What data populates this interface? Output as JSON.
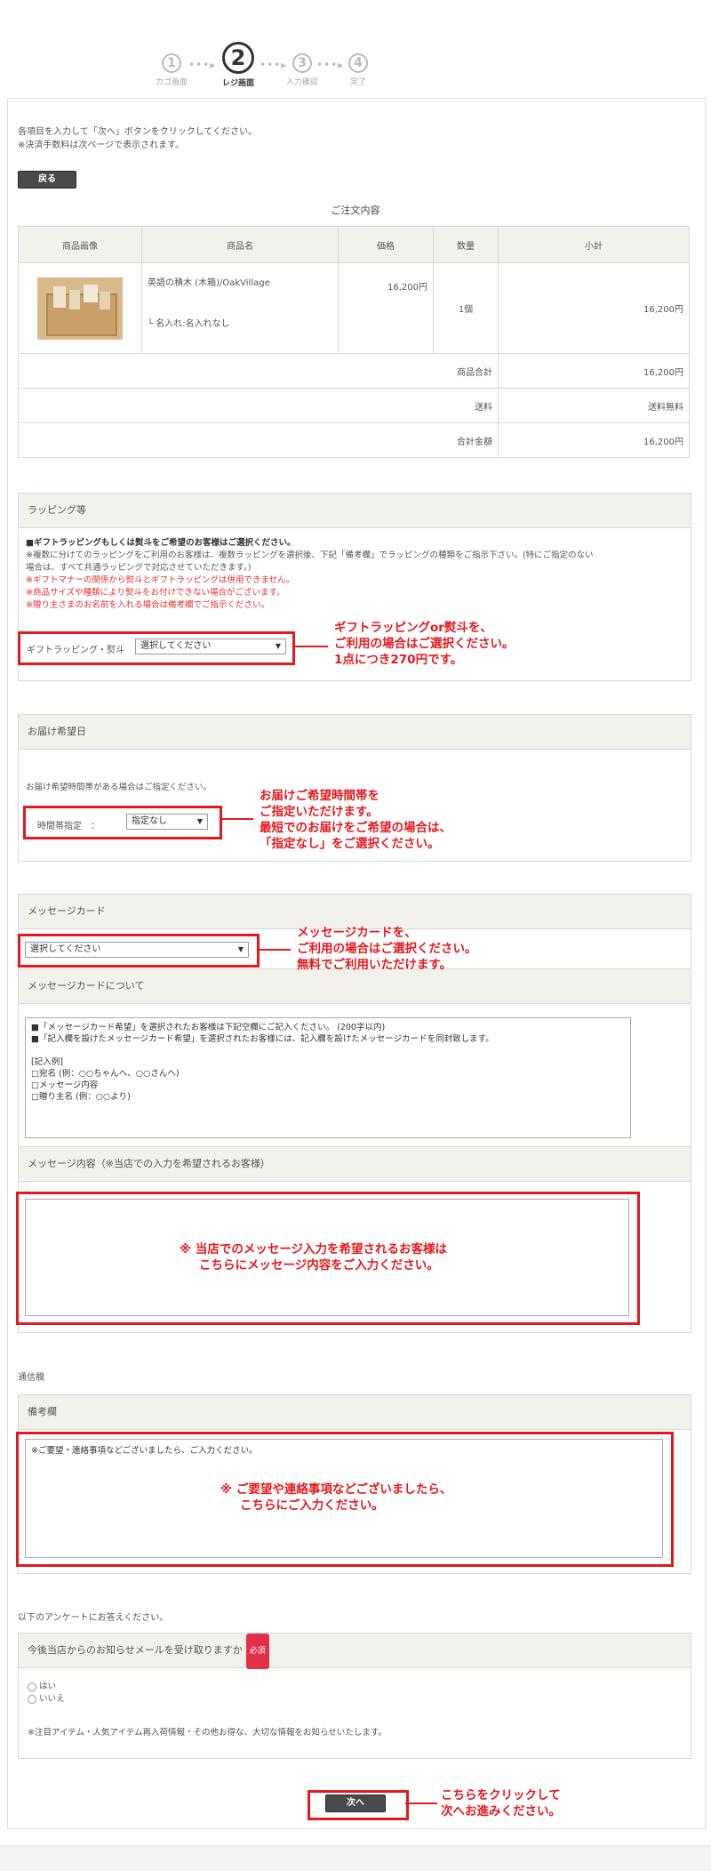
{
  "steps": [
    {
      "num": "①",
      "label": "カゴ画面"
    },
    {
      "num": "②",
      "label": "レジ画面"
    },
    {
      "num": "③",
      "label": "入力確認"
    },
    {
      "num": "④",
      "label": "完了"
    }
  ],
  "steps_dots": "•••▸",
  "intro": {
    "line1": "各項目を入力して「次へ」ボタンをクリックしてください。",
    "line2": "※決済手数料は次ページで表示されます。"
  },
  "back_button": "戻る",
  "order": {
    "title": "ご注文内容",
    "headers": [
      "商品画像",
      "商品名",
      "価格",
      "数量",
      "小計"
    ],
    "item": {
      "name": "英語の積木 (木箱)/OakVillage",
      "option": "└ 名入れ:名入れなし",
      "price": "16,200円",
      "qty": "1個",
      "subtotal": "16,200円"
    },
    "summary": [
      {
        "label": "商品合計",
        "value": "16,200円"
      },
      {
        "label": "送料",
        "value": "送料無料"
      },
      {
        "label": "合計金額",
        "value": "16,200円"
      }
    ]
  },
  "wrapping": {
    "title": "ラッピング等",
    "bold_note": "■ギフトラッピングもしくは熨斗をご希望のお客様はご選択ください。",
    "note1": "※複数に分けてのラッピングをご利用のお客様は、複数ラッピングを選択後、下記「備考欄」でラッピングの種類をご指示下さい。(特にご指定のない",
    "note1b": "場合は、すべて共通ラッピングで対応させていただきます。)",
    "red1": "※ギフトマナーの関係から熨斗とギフトラッピングは併用できません。",
    "red2": "※商品サイズや種類により熨斗をお付けできない場合がございます。",
    "red3": "※贈り主さまのお名前を入れる場合は備考欄でご指示ください。",
    "field_label": "ギフトラッピング・熨斗",
    "select_value": "選択してください",
    "annotation": [
      "ギフトラッピングor熨斗を、",
      "ご利用の場合はご選択ください。",
      "1点につき270円です。"
    ]
  },
  "delivery": {
    "title": "お届け希望日",
    "note": "お届け希望時間帯がある場合はご指定ください。",
    "field_label": "時間帯指定　：",
    "select_value": "指定なし",
    "annotation": [
      "お届けご希望時間帯を",
      "ご指定いただけます。",
      "最短でのお届けをご希望の場合は、",
      "「指定なし」をご選択ください。"
    ]
  },
  "message_card": {
    "title": "メッセージカード",
    "select_value": "選択してください",
    "annotation": [
      "メッセージカードを、",
      "ご利用の場合はご選択ください。",
      "無料でご利用いただけます。"
    ],
    "about_title": "メッセージカードについて",
    "about_lines": [
      "■「メッセージカード希望」を選択されたお客様は下記空欄にご記入ください。 (200字以内)",
      "■「記入欄を設けたメッセージカード希望」を選択されたお客様には、記入欄を設けたメッセージカードを同封致します。",
      "",
      "[記入例]",
      "□宛名 (例：○○ちゃんへ、○○さんへ)",
      "□メッセージ内容",
      "□贈り主名 (例：○○より)"
    ],
    "content_title": "メッセージ内容（※当店での入力を希望されるお客様）",
    "content_annotation": [
      "※ 当店でのメッセージ入力を希望されるお客様は",
      "こちらにメッセージ内容をご入力ください。"
    ]
  },
  "communication": {
    "section": "通信欄",
    "title": "備考欄",
    "placeholder": "※ご要望・連絡事項などございましたら、ご入力ください。",
    "annotation": [
      "※ ご要望や連絡事項などございましたら、",
      "こちらにご入力ください。"
    ]
  },
  "survey": {
    "intro": "以下のアンケートにお答えください。",
    "question": "今後当店からのお知らせメールを受け取りますか",
    "required": "必須",
    "options": [
      "はい",
      "いいえ"
    ],
    "note": "※注目アイテム・人気アイテム再入荷情報・その他お得な、大切な情報をお知らせいたします。"
  },
  "next_button": "次へ",
  "next_annotation": [
    "こちらをクリックして",
    "次へお進みください。"
  ],
  "colors": {
    "annotation_red": "#e5191d",
    "header_bg": "#f3f1ec",
    "button_dark": "#4a4a4a",
    "required_badge": "#e0304a"
  }
}
